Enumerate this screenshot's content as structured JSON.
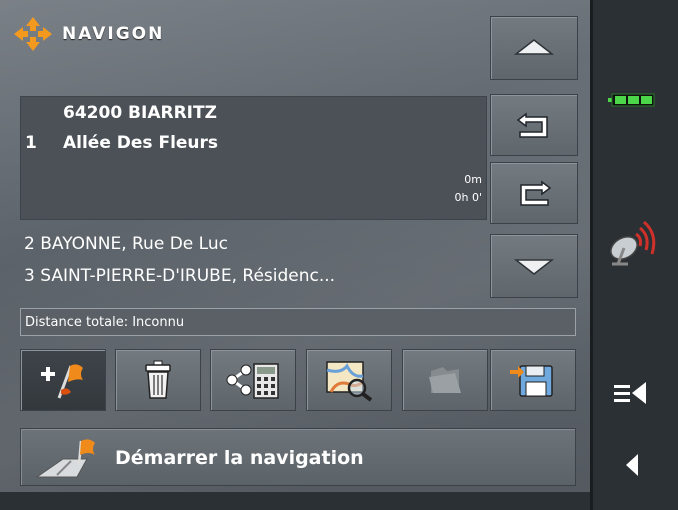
{
  "app": {
    "brand": "NAVIGON"
  },
  "route": {
    "city": "64200 BIARRITZ",
    "index": "1",
    "street": "Allée Des Fleurs",
    "distance": "0m",
    "time": "0h 0'"
  },
  "list": [
    {
      "text": "2 BAYONNE, Rue De Luc"
    },
    {
      "text": "3 SAINT-PIERRE-D'IRUBE, Résidenc..."
    }
  ],
  "distance_total": "Distance totale: Inconnu",
  "toolbar": [
    {
      "icon": "add-destination-icon"
    },
    {
      "icon": "trash-icon"
    },
    {
      "icon": "route-calculator-icon"
    },
    {
      "icon": "map-search-icon"
    },
    {
      "icon": "folder-icon"
    },
    {
      "icon": "save-icon"
    }
  ],
  "start_button": {
    "label": "Démarrer la navigation"
  },
  "colors": {
    "accent": "#f39a1e",
    "battery": "#4cd64a",
    "signal": "#d0302a"
  }
}
